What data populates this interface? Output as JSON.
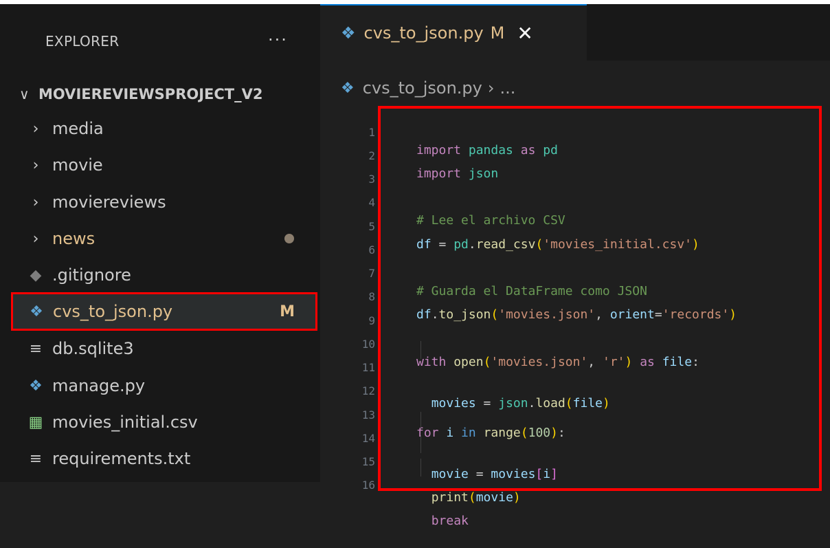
{
  "sidebar": {
    "header": "EXPLORER",
    "more": "···",
    "project": {
      "chevron": "∨",
      "name": "MOVIEREVIEWSPROJECT_V2"
    },
    "items": [
      {
        "label": "media",
        "type": "folder",
        "icon": "chevron-right-icon"
      },
      {
        "label": "movie",
        "type": "folder",
        "icon": "chevron-right-icon"
      },
      {
        "label": "moviereviews",
        "type": "folder",
        "icon": "chevron-right-icon"
      },
      {
        "label": "news",
        "type": "folder",
        "icon": "chevron-right-icon",
        "status": "modified-dot"
      },
      {
        "label": ".gitignore",
        "type": "file",
        "icon": "git-icon"
      },
      {
        "label": "cvs_to_json.py",
        "type": "file",
        "icon": "python-icon",
        "badge": "M",
        "selected": true
      },
      {
        "label": "db.sqlite3",
        "type": "file",
        "icon": "lines-icon"
      },
      {
        "label": "manage.py",
        "type": "file",
        "icon": "python-icon"
      },
      {
        "label": "movies_initial.csv",
        "type": "file",
        "icon": "table-icon"
      },
      {
        "label": "requirements.txt",
        "type": "file",
        "icon": "lines-icon"
      }
    ]
  },
  "tab": {
    "name": "cvs_to_json.py",
    "modified": "M",
    "close": "✕"
  },
  "breadcrumb": {
    "file": "cvs_to_json.py",
    "sep": "›",
    "rest": "..."
  },
  "code": {
    "line_numbers": [
      "1",
      "2",
      "3",
      "4",
      "5",
      "6",
      "7",
      "8",
      "9",
      "10",
      "11",
      "12",
      "13",
      "14",
      "15",
      "16"
    ],
    "lines": [
      "import pandas as pd",
      "import json",
      "",
      "# Lee el archivo CSV",
      "df = pd.read_csv('movies_initial.csv')",
      "",
      "# Guarda el DataFrame como JSON",
      "df.to_json('movies.json', orient='records')",
      "",
      "with open('movies.json', 'r') as file:",
      "  movies = json.load(file)",
      "",
      "for i in range(100):",
      "  movie = movies[i]",
      "  print(movie)",
      "  break"
    ]
  },
  "colors": {
    "accent": "#0078d4",
    "highlight_box": "#ff0000",
    "modified": "#e2c08d"
  }
}
